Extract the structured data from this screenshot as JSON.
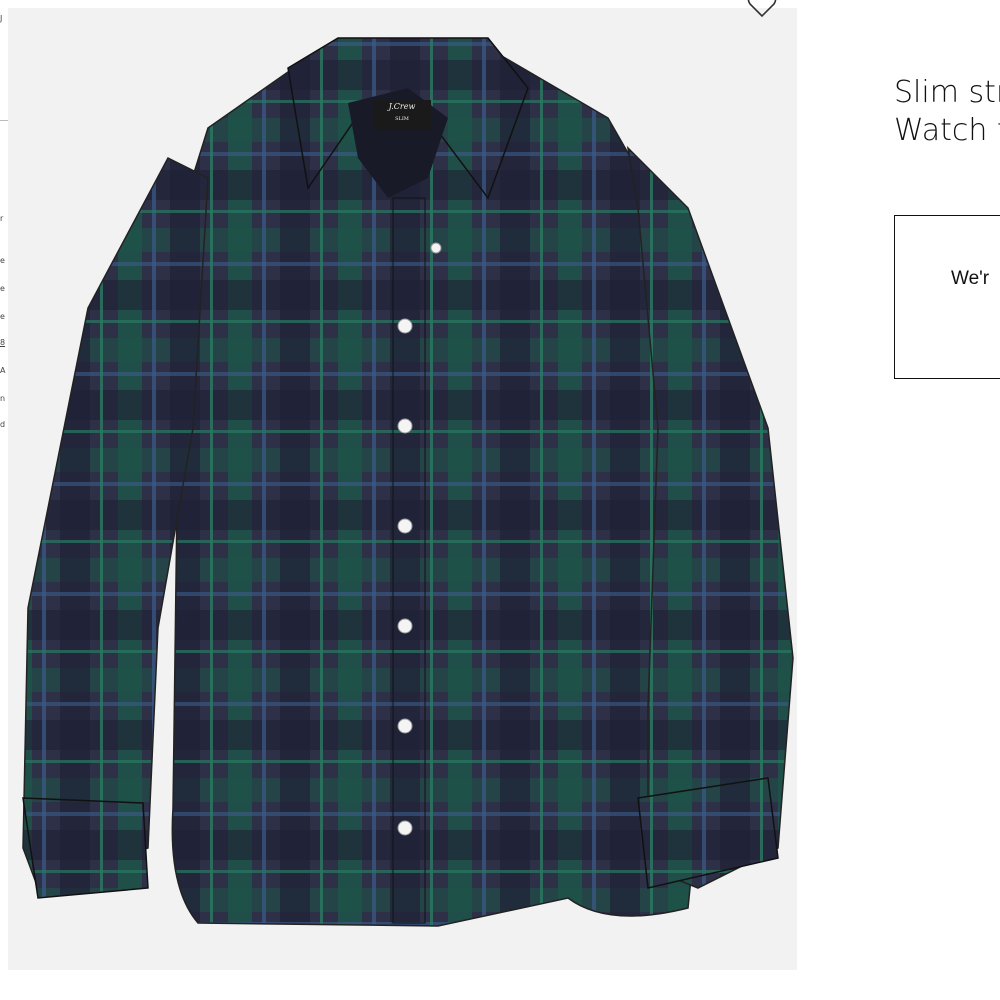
{
  "left_fragments": [
    "J",
    "r",
    "e",
    "e",
    "e",
    "8",
    "A",
    "n",
    "d"
  ],
  "product": {
    "title_line1": "Slim str",
    "title_line2": "Watch t",
    "tag_brand": "J.Crew",
    "tag_fit": "SLIM",
    "notice": "We'r"
  },
  "icons": {
    "wishlist": "heart-outline-icon"
  },
  "colors": {
    "plaid_navy": "#2e3047",
    "plaid_green": "#1d5348",
    "background_panel": "#f2f2f2",
    "text": "#111111"
  }
}
